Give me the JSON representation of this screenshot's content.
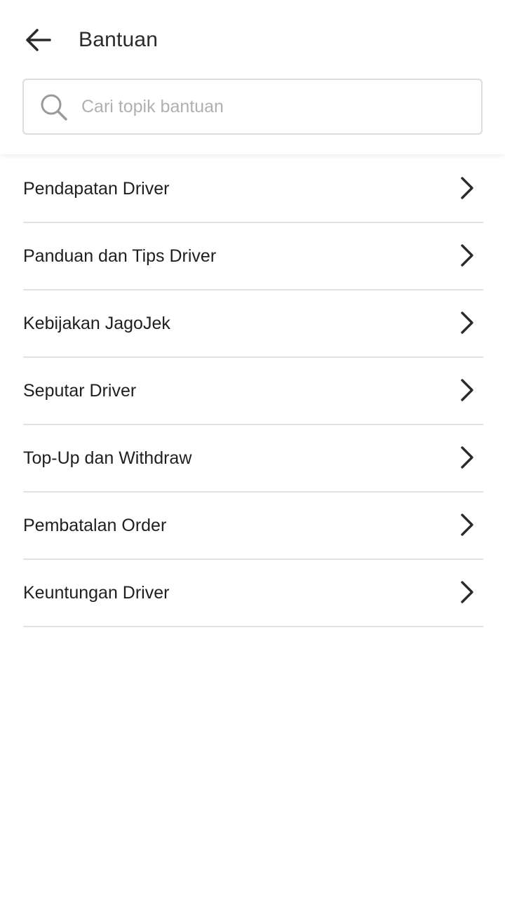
{
  "header": {
    "title": "Bantuan",
    "back_icon": "arrow-left-icon"
  },
  "search": {
    "placeholder": "Cari topik bantuan",
    "value": "",
    "icon": "search-icon"
  },
  "topics": [
    {
      "label": "Pendapatan Driver",
      "icon": "chevron-right-icon"
    },
    {
      "label": "Panduan dan Tips Driver",
      "icon": "chevron-right-icon"
    },
    {
      "label": "Kebijakan JagoJek",
      "icon": "chevron-right-icon"
    },
    {
      "label": "Seputar Driver",
      "icon": "chevron-right-icon"
    },
    {
      "label": "Top-Up dan Withdraw",
      "icon": "chevron-right-icon"
    },
    {
      "label": "Pembatalan Order",
      "icon": "chevron-right-icon"
    },
    {
      "label": "Keuntungan Driver",
      "icon": "chevron-right-icon"
    }
  ],
  "colors": {
    "text": "#222222",
    "placeholder": "#b0b0b0",
    "divider": "#e2e2e2",
    "border": "#dddddd"
  }
}
